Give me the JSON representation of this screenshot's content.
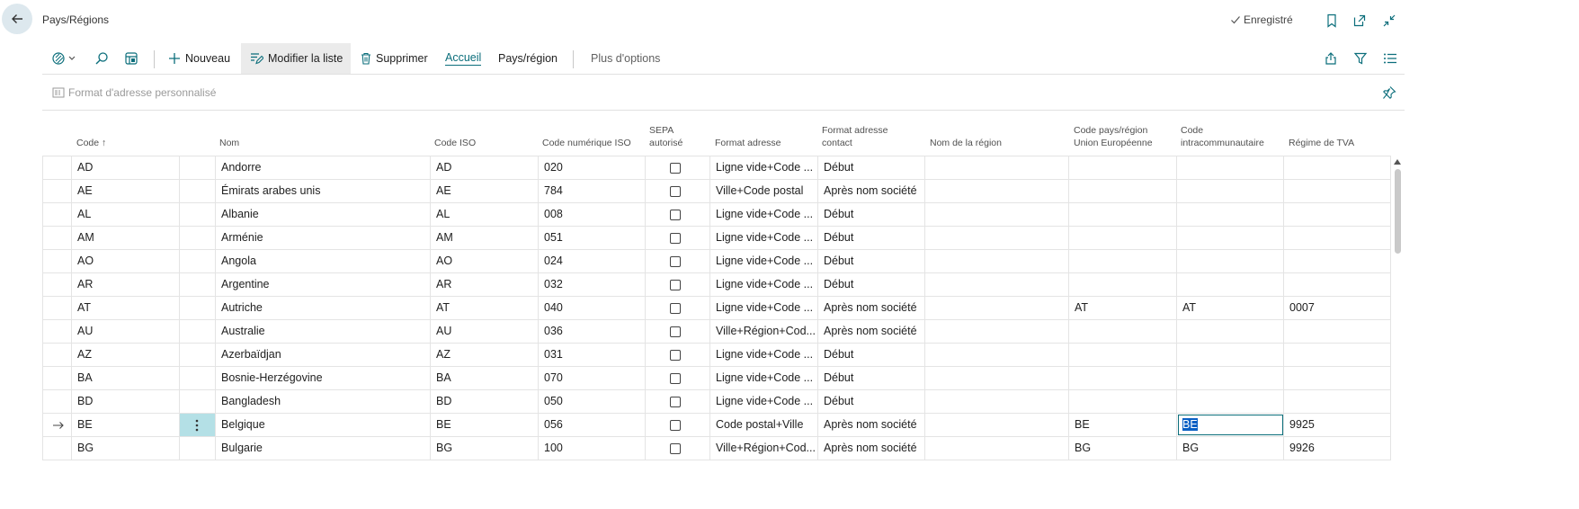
{
  "header": {
    "title": "Pays/Régions",
    "saved_status": "Enregistré"
  },
  "toolbar": {
    "new": "Nouveau",
    "edit_list": "Modifier la liste",
    "delete": "Supprimer",
    "home": "Accueil",
    "country_region": "Pays/région",
    "more_options": "Plus d'options"
  },
  "subbar": {
    "custom_address_format": "Format d'adresse personnalisé"
  },
  "columns": {
    "code": "Code",
    "nom": "Nom",
    "code_iso": "Code ISO",
    "code_num_iso": "Code numérique ISO",
    "sepa_1": "SEPA",
    "sepa_2": "autorisé",
    "format_adresse": "Format adresse",
    "format_contact_1": "Format adresse",
    "format_contact_2": "contact",
    "nom_region": "Nom de la région",
    "code_ue_1": "Code pays/région",
    "code_ue_2": "Union Européenne",
    "code_intra_1": "Code",
    "code_intra_2": "intracommunautaire",
    "regime_tva": "Régime de TVA"
  },
  "rows": [
    {
      "code": "AD",
      "nom": "Andorre",
      "iso": "AD",
      "num": "020",
      "fmt": "Ligne vide+Code ...",
      "contact": "Début",
      "region": "",
      "ue": "",
      "intra": "",
      "tva": ""
    },
    {
      "code": "AE",
      "nom": "Émirats arabes unis",
      "iso": "AE",
      "num": "784",
      "fmt": "Ville+Code postal",
      "contact": "Après nom société",
      "region": "",
      "ue": "",
      "intra": "",
      "tva": ""
    },
    {
      "code": "AL",
      "nom": "Albanie",
      "iso": "AL",
      "num": "008",
      "fmt": "Ligne vide+Code ...",
      "contact": "Début",
      "region": "",
      "ue": "",
      "intra": "",
      "tva": ""
    },
    {
      "code": "AM",
      "nom": "Arménie",
      "iso": "AM",
      "num": "051",
      "fmt": "Ligne vide+Code ...",
      "contact": "Début",
      "region": "",
      "ue": "",
      "intra": "",
      "tva": ""
    },
    {
      "code": "AO",
      "nom": "Angola",
      "iso": "AO",
      "num": "024",
      "fmt": "Ligne vide+Code ...",
      "contact": "Début",
      "region": "",
      "ue": "",
      "intra": "",
      "tva": ""
    },
    {
      "code": "AR",
      "nom": "Argentine",
      "iso": "AR",
      "num": "032",
      "fmt": "Ligne vide+Code ...",
      "contact": "Début",
      "region": "",
      "ue": "",
      "intra": "",
      "tva": ""
    },
    {
      "code": "AT",
      "nom": "Autriche",
      "iso": "AT",
      "num": "040",
      "fmt": "Ligne vide+Code ...",
      "contact": "Après nom société",
      "region": "",
      "ue": "AT",
      "intra": "AT",
      "tva": "0007"
    },
    {
      "code": "AU",
      "nom": "Australie",
      "iso": "AU",
      "num": "036",
      "fmt": "Ville+Région+Cod...",
      "contact": "Après nom société",
      "region": "",
      "ue": "",
      "intra": "",
      "tva": ""
    },
    {
      "code": "AZ",
      "nom": "Azerbaïdjan",
      "iso": "AZ",
      "num": "031",
      "fmt": "Ligne vide+Code ...",
      "contact": "Début",
      "region": "",
      "ue": "",
      "intra": "",
      "tva": ""
    },
    {
      "code": "BA",
      "nom": "Bosnie-Herzégovine",
      "iso": "BA",
      "num": "070",
      "fmt": "Ligne vide+Code ...",
      "contact": "Début",
      "region": "",
      "ue": "",
      "intra": "",
      "tva": ""
    },
    {
      "code": "BD",
      "nom": "Bangladesh",
      "iso": "BD",
      "num": "050",
      "fmt": "Ligne vide+Code ...",
      "contact": "Début",
      "region": "",
      "ue": "",
      "intra": "",
      "tva": ""
    },
    {
      "code": "BE",
      "nom": "Belgique",
      "iso": "BE",
      "num": "056",
      "fmt": "Code postal+Ville",
      "contact": "Après nom société",
      "region": "",
      "ue": "BE",
      "intra": "BE",
      "tva": "9925",
      "current": true
    },
    {
      "code": "BG",
      "nom": "Bulgarie",
      "iso": "BG",
      "num": "100",
      "fmt": "Ville+Région+Cod...",
      "contact": "Après nom société",
      "region": "",
      "ue": "BG",
      "intra": "BG",
      "tva": "9926"
    }
  ],
  "icons": {
    "back": "arrow-left-icon",
    "bookmark": "bookmark-icon",
    "open_new": "open-in-new-window-icon",
    "collapse": "collapse-icon",
    "search": "search-icon",
    "filter": "filter-icon",
    "list": "list-icon",
    "share": "share-icon"
  },
  "colors": {
    "accent": "#0b6e7b",
    "row_menu_bg": "#b4e0e6",
    "selection": "#0a5fc4"
  }
}
